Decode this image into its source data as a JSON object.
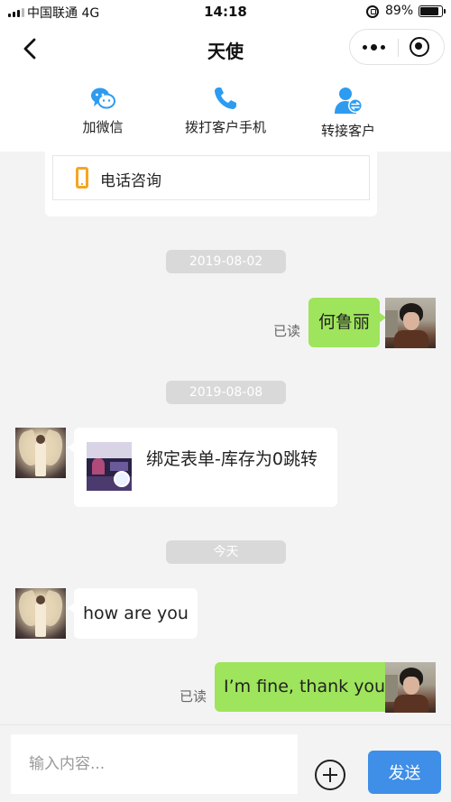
{
  "status_bar": {
    "carrier": "中国联通",
    "network": "4G",
    "time": "14:18",
    "battery": "89%",
    "battery_level": 0.89
  },
  "nav": {
    "title": "天使"
  },
  "actions": [
    {
      "label": "加微信",
      "icon": "wechat-icon"
    },
    {
      "label": "拨打客户手机",
      "icon": "phone-icon"
    },
    {
      "label": "转接客户",
      "icon": "transfer-user-icon"
    }
  ],
  "phone_card": {
    "label": "电话咨询"
  },
  "messages": {
    "date_1": "2019-08-02",
    "msg_1_text": "何鲁丽",
    "msg_1_status": "已读",
    "date_2": "2019-08-08",
    "msg_2_card_text": "绑定表单-库存为0跳转",
    "date_3": "今天",
    "msg_3_text": "how are you",
    "msg_4_text": "I’m fine, thank you",
    "msg_4_status": "已读"
  },
  "input": {
    "placeholder": "输入内容...",
    "send_label": "发送"
  },
  "colors": {
    "accent": "#3f8ee8",
    "my_bubble": "#9ee45c",
    "icon_blue": "#2d9cf0",
    "phone_icon": "#f5a623"
  }
}
